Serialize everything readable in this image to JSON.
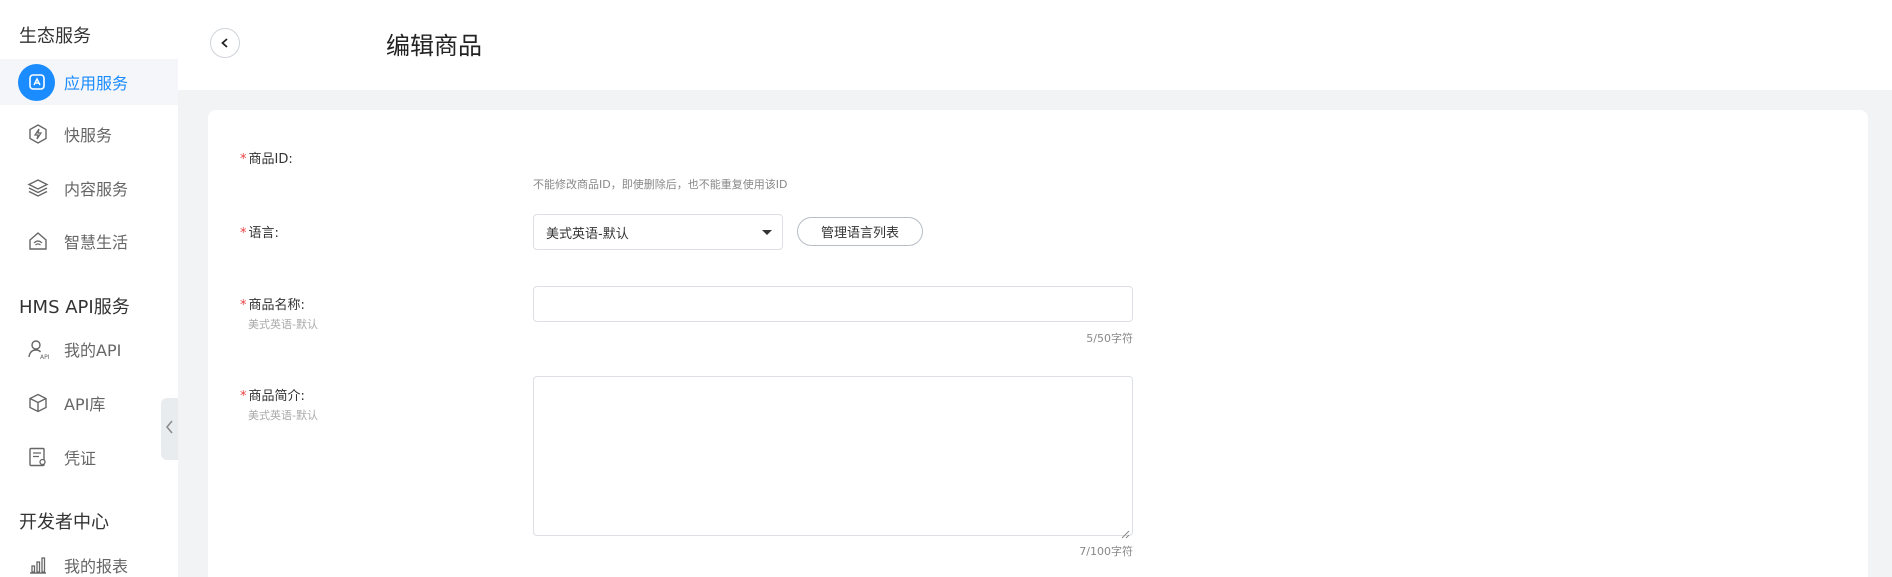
{
  "sidebar": {
    "sections": [
      {
        "title": "生态服务"
      },
      {
        "title": "HMS API服务"
      },
      {
        "title": "开发者中心"
      }
    ],
    "items": [
      {
        "label": "应用服务",
        "icon": "app-store-icon"
      },
      {
        "label": "快服务",
        "icon": "quick-service-icon"
      },
      {
        "label": "内容服务",
        "icon": "layers-icon"
      },
      {
        "label": "智慧生活",
        "icon": "smart-home-icon"
      },
      {
        "label": "我的API",
        "icon": "user-api-icon"
      },
      {
        "label": "API库",
        "icon": "cube-icon"
      },
      {
        "label": "凭证",
        "icon": "credential-icon"
      },
      {
        "label": "我的报表",
        "icon": "bar-chart-icon"
      }
    ]
  },
  "header": {
    "title": "编辑商品"
  },
  "form": {
    "product_id": {
      "label": "商品ID:",
      "hint": "不能修改商品ID，即使删除后，也不能重复使用该ID"
    },
    "language": {
      "label": "语言:",
      "selected": "美式英语-默认",
      "manage_button": "管理语言列表"
    },
    "name": {
      "label": "商品名称:",
      "sub": "美式英语-默认",
      "value": "",
      "counter": "5/50字符"
    },
    "intro": {
      "label": "商品简介:",
      "sub": "美式英语-默认",
      "value": "",
      "counter": "7/100字符"
    }
  },
  "colors": {
    "accent": "#1a8cff",
    "required": "#e84040"
  }
}
